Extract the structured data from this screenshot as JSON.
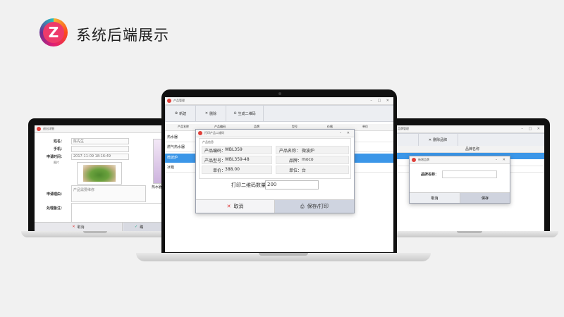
{
  "slide": {
    "title": "系统后端展示",
    "logo_letter": "Z"
  },
  "left_laptop": {
    "window_title": "退出详细",
    "name_label": "姓名：",
    "name_value": "陈先生",
    "phone_label": "手机：",
    "time_label": "申请时间：",
    "time_value": "2017-11-09 18:16:49",
    "image_label": "图片",
    "product_label": "热水器",
    "apply_label": "申请理由：",
    "apply_value": "产品需要维修",
    "remark_label": "处理备注：",
    "cancel_label": "取消",
    "confirm_label": "确"
  },
  "center_laptop": {
    "window_title": "产品管理",
    "toolbar": {
      "new_label": "新建",
      "delete_label": "删除",
      "qr_label": "生成二维码"
    },
    "columns": [
      "产品名称",
      "产品编码",
      "品牌",
      "型号",
      "价格",
      "单位"
    ],
    "rows": [
      "热水器",
      "燃气热水器",
      "微波炉",
      "冰箱"
    ],
    "dialog": {
      "title": "打印产品二维码",
      "section_label": "产品信息",
      "code_label": "产品编码：",
      "code_value": "WBL359",
      "name_label": "产品名称：",
      "name_value": "微波炉",
      "model_label": "产品型号：",
      "model_value": "WBL359-48",
      "brand_label": "品牌：",
      "brand_value": "moco",
      "price_label": "单价：",
      "price_value": "388.00",
      "unit_label": "单位：",
      "unit_value": "台",
      "qty_label": "打印二维码数量：",
      "qty_value": "200",
      "cancel_label": "取消",
      "save_label": "保存/打印"
    }
  },
  "right_laptop": {
    "window_title": "品牌管理",
    "delete_label": "删除品牌",
    "column": "品牌名称",
    "dialog": {
      "title": "新增品牌",
      "name_label": "品牌名称：",
      "cancel_label": "取消",
      "save_label": "保存"
    }
  }
}
